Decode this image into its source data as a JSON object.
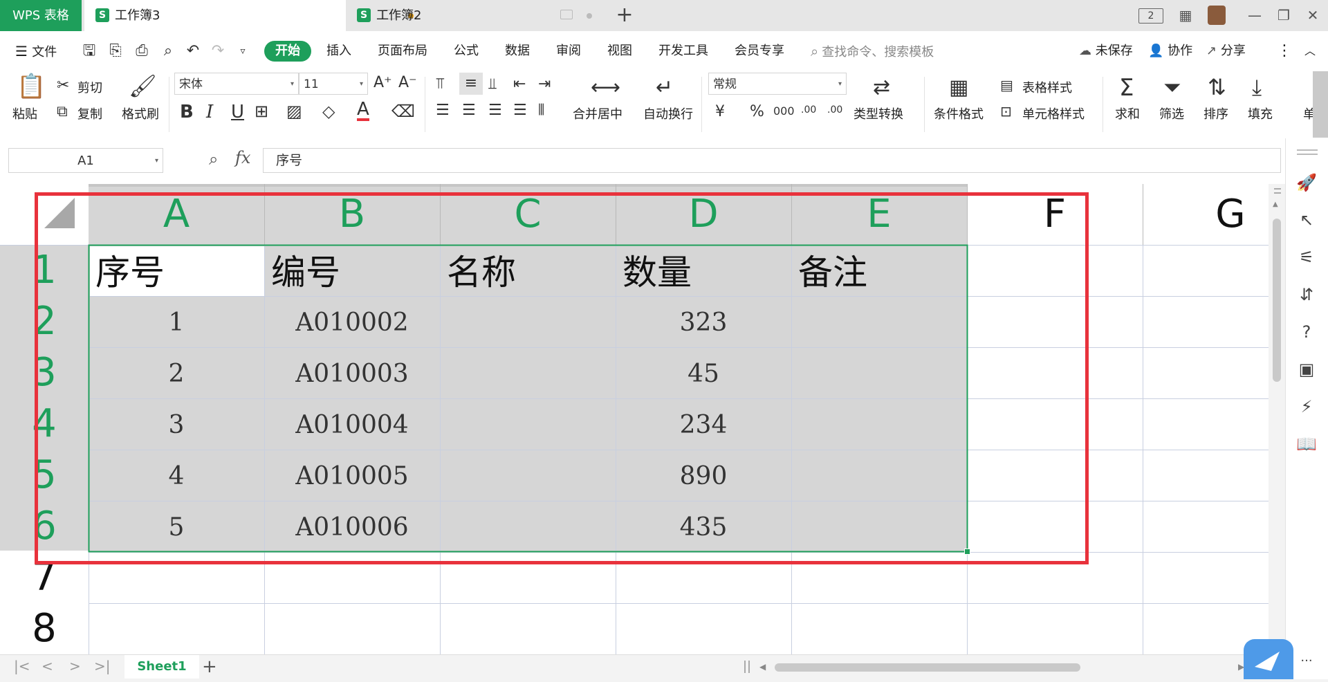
{
  "titlebar": {
    "app_name": "WPS 表格",
    "tabs": [
      {
        "label": "工作簿3",
        "icon": "S",
        "active": true
      },
      {
        "label": "工作簿2",
        "icon": "S",
        "active": false
      }
    ],
    "add_tab": "+",
    "page_count": "2"
  },
  "menu": {
    "file": "文件",
    "items": [
      "开始",
      "插入",
      "页面布局",
      "公式",
      "数据",
      "审阅",
      "视图",
      "开发工具",
      "会员专享"
    ],
    "search_placeholder": "查找命令、搜索模板",
    "unsaved": "未保存",
    "collab": "协作",
    "share": "分享"
  },
  "ribbon": {
    "paste": "粘贴",
    "cut": "剪切",
    "copy": "复制",
    "format_painter": "格式刷",
    "font_name": "宋体",
    "font_size": "11",
    "bold": "B",
    "italic": "I",
    "underline": "U",
    "font_color_glyph": "A",
    "merge_center": "合并居中",
    "wrap_text": "自动换行",
    "number_format": "常规",
    "currency": "¥",
    "percent": "%",
    "thousands": "000",
    "dec_increase": ".00",
    "dec_decrease": ".00",
    "type_convert": "类型转换",
    "conditional_format": "条件格式",
    "table_style": "表格样式",
    "cell_style": "单元格样式",
    "sum": "求和",
    "filter": "筛选",
    "sort": "排序",
    "fill": "填充",
    "more": "单"
  },
  "formula": {
    "cell_ref": "A1",
    "fx": "fx",
    "content": "序号"
  },
  "grid": {
    "columns": [
      "A",
      "B",
      "C",
      "D",
      "E",
      "F",
      "G"
    ],
    "rows": [
      "1",
      "2",
      "3",
      "4",
      "5",
      "6",
      "7",
      "8"
    ],
    "header_row": [
      "序号",
      "编号",
      "名称",
      "数量",
      "备注"
    ],
    "data": [
      [
        "1",
        "A010002",
        "",
        "323",
        ""
      ],
      [
        "2",
        "A010003",
        "",
        "45",
        ""
      ],
      [
        "3",
        "A010004",
        "",
        "234",
        ""
      ],
      [
        "4",
        "A010005",
        "",
        "890",
        ""
      ],
      [
        "5",
        "A010006",
        "",
        "435",
        ""
      ]
    ]
  },
  "sheets": [
    "Sheet1"
  ],
  "colors": {
    "brand_green": "#1e9f5b",
    "selection_gray": "#d6d6d6",
    "highlight_red": "#e8323c"
  }
}
